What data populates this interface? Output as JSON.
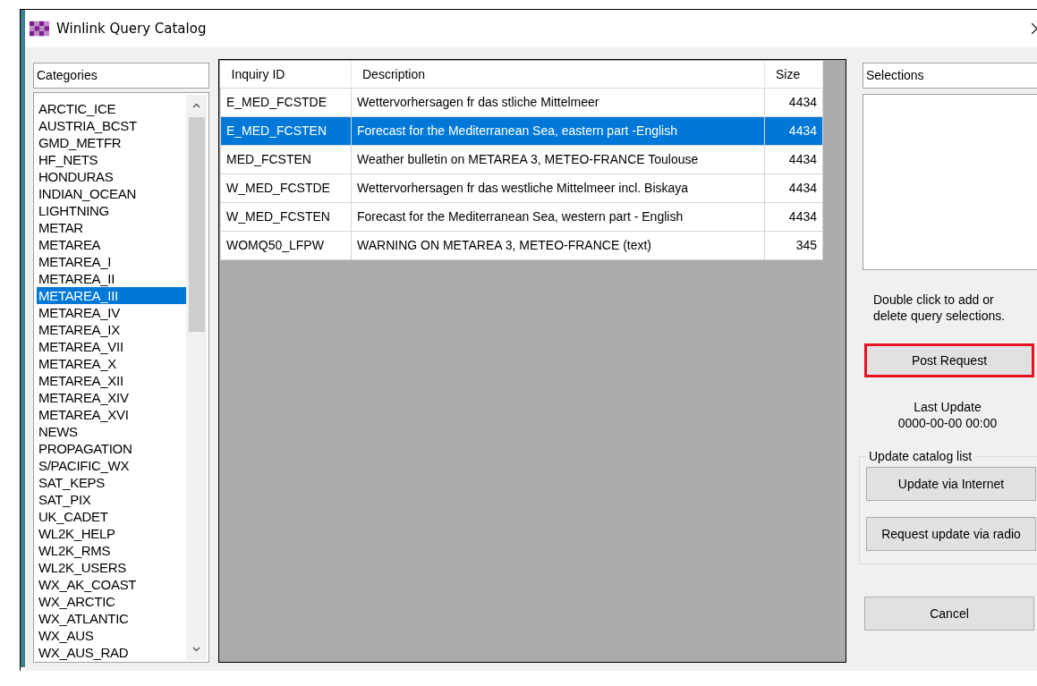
{
  "window": {
    "title": "Winlink Query Catalog"
  },
  "categories": {
    "header": "Categories",
    "items": [
      {
        "label": "ARCTIC_ICE",
        "selected": false
      },
      {
        "label": "AUSTRIA_BCST",
        "selected": false
      },
      {
        "label": "GMD_METFR",
        "selected": false
      },
      {
        "label": "HF_NETS",
        "selected": false
      },
      {
        "label": "HONDURAS",
        "selected": false
      },
      {
        "label": "INDIAN_OCEAN",
        "selected": false
      },
      {
        "label": "LIGHTNING",
        "selected": false
      },
      {
        "label": "METAR",
        "selected": false
      },
      {
        "label": "METAREA",
        "selected": false
      },
      {
        "label": "METAREA_I",
        "selected": false
      },
      {
        "label": "METAREA_II",
        "selected": false
      },
      {
        "label": "METAREA_III",
        "selected": true
      },
      {
        "label": "METAREA_IV",
        "selected": false
      },
      {
        "label": "METAREA_IX",
        "selected": false
      },
      {
        "label": "METAREA_VII",
        "selected": false
      },
      {
        "label": "METAREA_X",
        "selected": false
      },
      {
        "label": "METAREA_XII",
        "selected": false
      },
      {
        "label": "METAREA_XIV",
        "selected": false
      },
      {
        "label": "METAREA_XVI",
        "selected": false
      },
      {
        "label": "NEWS",
        "selected": false
      },
      {
        "label": "PROPAGATION",
        "selected": false
      },
      {
        "label": "S/PACIFIC_WX",
        "selected": false
      },
      {
        "label": "SAT_KEPS",
        "selected": false
      },
      {
        "label": "SAT_PIX",
        "selected": false
      },
      {
        "label": "UK_CADET",
        "selected": false
      },
      {
        "label": "WL2K_HELP",
        "selected": false
      },
      {
        "label": "WL2K_RMS",
        "selected": false
      },
      {
        "label": "WL2K_USERS",
        "selected": false
      },
      {
        "label": "WX_AK_COAST",
        "selected": false
      },
      {
        "label": "WX_ARCTIC",
        "selected": false
      },
      {
        "label": "WX_ATLANTIC",
        "selected": false
      },
      {
        "label": "WX_AUS",
        "selected": false
      },
      {
        "label": "WX_AUS_RAD",
        "selected": false
      }
    ]
  },
  "table": {
    "columns": [
      "Inquiry ID",
      "Description",
      "Size"
    ],
    "rows": [
      {
        "cells": [
          "E_MED_FCSTDE",
          "Wettervorhersagen fr das stliche Mittelmeer",
          "4434"
        ],
        "selected": false
      },
      {
        "cells": [
          "E_MED_FCSTEN",
          "Forecast for the Mediterranean Sea, eastern part -English",
          "4434"
        ],
        "selected": true
      },
      {
        "cells": [
          "MED_FCSTEN",
          "Weather bulletin on METAREA 3, METEO-FRANCE Toulouse",
          "4434"
        ],
        "selected": false
      },
      {
        "cells": [
          "W_MED_FCSTDE",
          "Wettervorhersagen fr das westliche Mittelmeer incl. Biskaya",
          "4434"
        ],
        "selected": false
      },
      {
        "cells": [
          "W_MED_FCSTEN",
          "Forecast for the Mediterranean Sea, western part - English",
          "4434"
        ],
        "selected": false
      },
      {
        "cells": [
          "WOMQ50_LFPW",
          "WARNING ON METAREA 3, METEO-FRANCE (text)",
          "345"
        ],
        "selected": false
      }
    ]
  },
  "selections": {
    "header": "Selections"
  },
  "hint": "Double click to add or delete query selections.",
  "post_request": {
    "label": "Post Request",
    "highlighted": true
  },
  "last_update": {
    "label": "Last Update",
    "value": "0000-00-00 00:00"
  },
  "update_group": {
    "title": "Update catalog list",
    "buttons": [
      "Update via Internet",
      "Request update via radio"
    ]
  },
  "cancel": {
    "label": "Cancel"
  }
}
